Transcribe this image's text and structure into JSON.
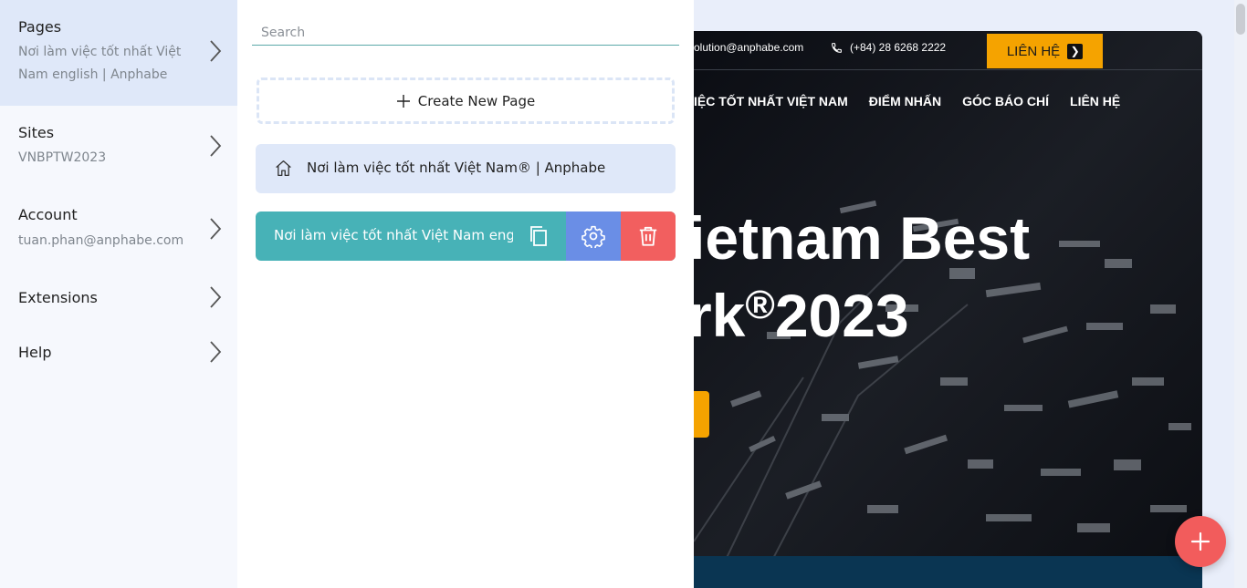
{
  "sidebar": {
    "items": [
      {
        "title": "Pages",
        "subtitle": "Nơi làm việc tốt nhất Việt Nam english | Anphabe"
      },
      {
        "title": "Sites",
        "subtitle": "VNBPTW2023"
      },
      {
        "title": "Account",
        "subtitle": "tuan.phan@anphabe.com"
      },
      {
        "title": "Extensions"
      },
      {
        "title": "Help"
      }
    ]
  },
  "pages_panel": {
    "search_placeholder": "Search",
    "create_label": "Create New Page",
    "pages": [
      {
        "label": "Nơi làm việc tốt nhất Việt Nam® | Anphabe",
        "is_home": true
      },
      {
        "label": "Nơi làm việc tốt nhất Việt Nam english",
        "active": true
      }
    ]
  },
  "preview": {
    "email": "olution@anphabe.com",
    "phone": "(+84) 28 6268 2222",
    "cta": "LIÊN HỆ",
    "nav": [
      "IỆC TỐT NHẤT VIỆT NAM",
      "ĐIỂM NHẤN",
      "GÓC BÁO CHÍ",
      "LIÊN HỆ"
    ],
    "hero_line1": "ietnam Best",
    "hero_line2_a": "rk",
    "hero_line2_sup": "®",
    "hero_line2_b": "2023"
  },
  "colors": {
    "accent_teal": "#47b2b7",
    "settings_blue": "#6a8ee6",
    "delete_red": "#f25f5f",
    "fab_red": "#f25c5c",
    "cta_orange": "#f5a300",
    "active_bg": "#dfe8f9"
  },
  "icons": {
    "chevron": "chevron-right-icon",
    "home": "home-icon",
    "copy": "copy-icon",
    "settings": "gear-icon",
    "delete": "trash-icon",
    "add": "plus-icon",
    "phone": "phone-icon"
  }
}
